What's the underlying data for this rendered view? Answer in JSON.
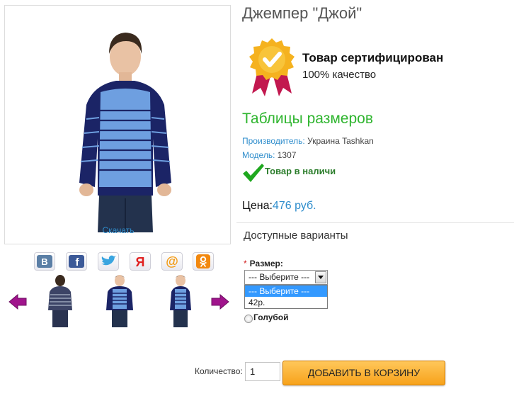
{
  "product": {
    "title": "Джемпер \"Джой\"",
    "download_link": "Скачать"
  },
  "certificate": {
    "title": "Товар сертифицирован",
    "subtitle": "100% качество"
  },
  "size_table_link": "Таблицы размеров",
  "info": {
    "manufacturer_label": "Производитель:",
    "manufacturer_value": "Украина Tashkan",
    "model_label": "Модель:",
    "model_value": "1307"
  },
  "stock": {
    "text": "Товар в наличи"
  },
  "price": {
    "label": "Цена:",
    "value": "476 руб."
  },
  "variants": {
    "title": "Доступные варианты",
    "size_label": "Размер:",
    "required_mark": "*",
    "select_value": "--- Выберите ---",
    "options": [
      "--- Выберите ---",
      "42р."
    ],
    "color_option": "Голубой"
  },
  "cart": {
    "quantity_label": "Количество:",
    "quantity_value": "1",
    "add_button": "ДОБАВИТЬ В КОРЗИНУ"
  },
  "share": {
    "icons": [
      "vk-icon",
      "facebook-icon",
      "twitter-icon",
      "yandex-icon",
      "mail-icon",
      "odnoklassniki-icon"
    ]
  },
  "colors": {
    "link_blue": "#2e8dcc",
    "size_table_green": "#2fb52f",
    "stock_green": "#2b7d2b",
    "button_orange": "#f7a21b",
    "arrow_magenta": "#a0148c",
    "sweater_blue": "#6e9fe0",
    "sweater_navy": "#1b2466"
  }
}
